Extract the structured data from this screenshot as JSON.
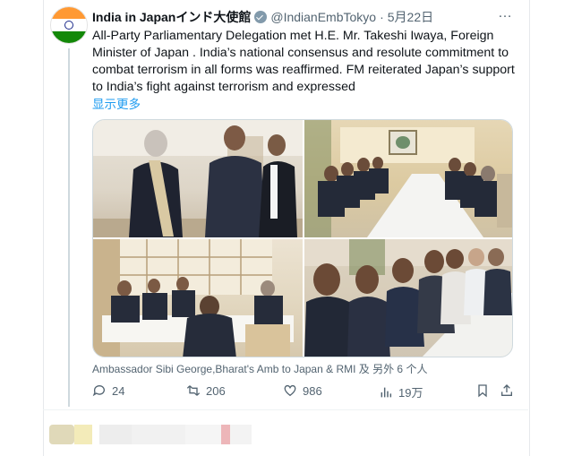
{
  "tweet": {
    "author_name": "India in Japanインド大使館",
    "handle": "@IndianEmbTokyo",
    "separator": "·",
    "date": "5月22日",
    "more_icon": "…",
    "text": "All-Party Parliamentary Delegation met  H.E. Mr. Takeshi Iwaya, Foreign Minister of Japan . India’s national consensus and resolute commitment to combat terrorism in all forms was reaffirmed. FM reiterated Japan’s support to India’s fight against terrorism and expressed",
    "show_more": "显示更多",
    "media_caption": "Ambassador Sibi George,Bharat's Amb to Japan & RMI 及 另外 6 个人",
    "actions": {
      "replies": "24",
      "retweets": "206",
      "likes": "986",
      "views": "19万"
    }
  },
  "colors": {
    "accent": "#1d9bf0",
    "muted": "#536471",
    "badge": "#829aab",
    "flag_saffron": "#ff9933",
    "flag_white": "#ffffff",
    "flag_green": "#138808"
  },
  "icons": [
    "india-flag-avatar",
    "verified-badge-icon",
    "more-icon",
    "reply-icon",
    "retweet-icon",
    "like-icon",
    "views-icon",
    "bookmark-icon",
    "share-icon"
  ]
}
